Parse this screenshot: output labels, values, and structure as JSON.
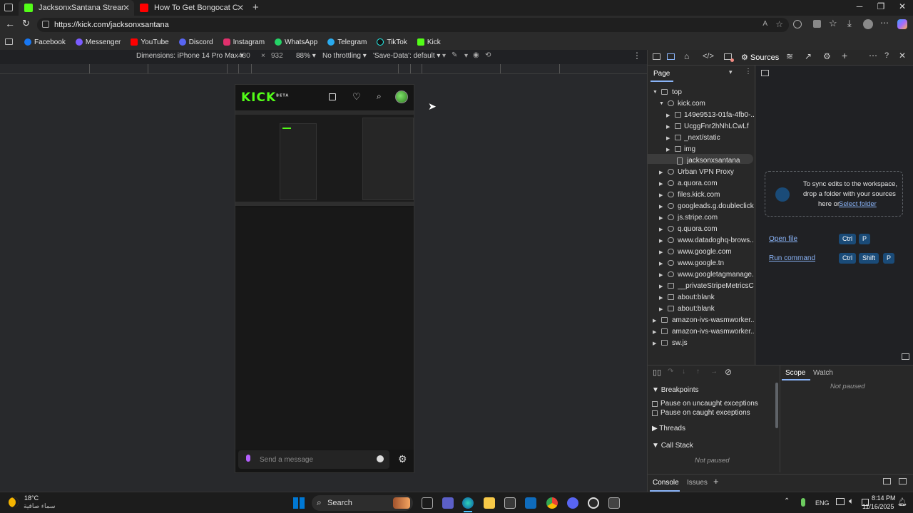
{
  "tabs": [
    {
      "title": "JacksonxSantana Stream - Watch",
      "active": true
    },
    {
      "title": "How To Get Bongocat Cam (OBS",
      "active": false
    }
  ],
  "address": {
    "url": "https://kick.com/jacksonxsantana"
  },
  "bookmarks": [
    "Facebook",
    "Messenger",
    "YouTube",
    "Discord",
    "Instagram",
    "WhatsApp",
    "Telegram",
    "TikTok",
    "Kick"
  ],
  "device_toolbar": {
    "dimensions_label": "Dimensions: iPhone 14 Pro Max",
    "width": "430",
    "times": "×",
    "height": "932",
    "zoom": "88%",
    "throttling": "No throttling",
    "save_data": "'Save-Data': default"
  },
  "kick": {
    "logo": "KICK",
    "beta": "BETA",
    "message_placeholder": "Send a message"
  },
  "devtools": {
    "active_tab": "Sources",
    "page_tab": "Page",
    "tree": [
      {
        "label": "top"
      },
      {
        "label": "kick.com"
      },
      {
        "label": "149e9513-01fa-4fb0-..."
      },
      {
        "label": "UcggFnr2hNhLCwLf"
      },
      {
        "label": "_next/static"
      },
      {
        "label": "img"
      },
      {
        "label": "jacksonxsantana"
      },
      {
        "label": "Urban VPN Proxy"
      },
      {
        "label": "a.quora.com"
      },
      {
        "label": "files.kick.com"
      },
      {
        "label": "googleads.g.doubleclick..."
      },
      {
        "label": "js.stripe.com"
      },
      {
        "label": "q.quora.com"
      },
      {
        "label": "www.datadoghq-brows..."
      },
      {
        "label": "www.google.com"
      },
      {
        "label": "www.google.tn"
      },
      {
        "label": "www.googletagmanage..."
      },
      {
        "label": "__privateStripeMetricsC..."
      },
      {
        "label": "about:blank"
      },
      {
        "label": "about:blank"
      },
      {
        "label": "amazon-ivs-wasmworker...."
      },
      {
        "label": "amazon-ivs-wasmworker...."
      },
      {
        "label": "sw.js"
      }
    ],
    "sync_text_1": "To sync edits to the workspace,",
    "sync_text_2": "drop a folder with your sources",
    "sync_text_3": "here or",
    "select_folder": "Select folder",
    "open_file": "Open file",
    "run_command": "Run command",
    "kbd_ctrl": "Ctrl",
    "kbd_p": "P",
    "kbd_shift": "Shift",
    "breakpoints": "Breakpoints",
    "pause_uncaught": "Pause on uncaught exceptions",
    "pause_caught": "Pause on caught exceptions",
    "threads": "Threads",
    "call_stack": "Call Stack",
    "not_paused": "Not paused",
    "scope": "Scope",
    "watch": "Watch",
    "console": "Console",
    "issues": "Issues"
  },
  "taskbar": {
    "weather_temp": "18°C",
    "weather_desc": "سماء صافية",
    "search": "Search",
    "lang": "ENG",
    "time": "8:14 PM",
    "date": "11/16/2025"
  }
}
